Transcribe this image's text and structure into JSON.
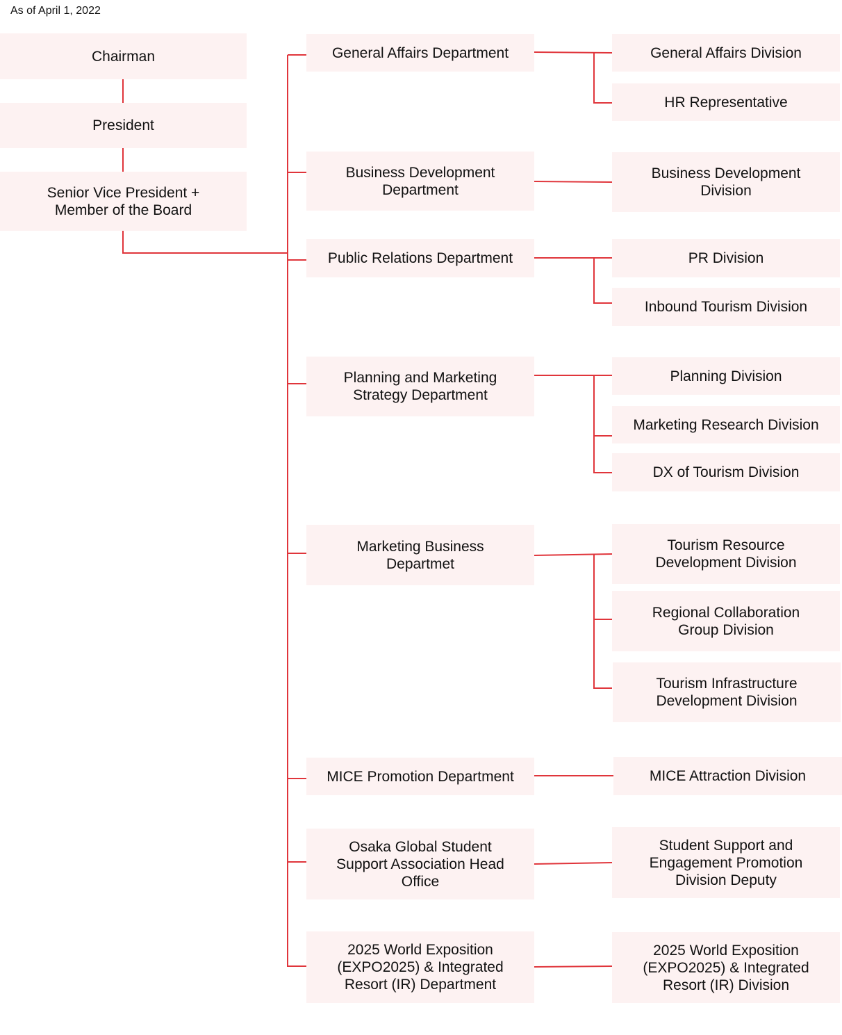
{
  "date_label": "As of April 1, 2022",
  "line_color": "#e0353b",
  "box_color": "#fdf2f2",
  "executives": [
    {
      "id": "chairman",
      "label": "Chairman"
    },
    {
      "id": "president",
      "label": "President"
    },
    {
      "id": "svp",
      "label": "Senior Vice President +\nMember of the Board"
    }
  ],
  "departments": [
    {
      "id": "general-affairs",
      "label": "General Affairs Department",
      "divisions": [
        "General Affairs Division",
        "HR Representative"
      ]
    },
    {
      "id": "business-development",
      "label": "Business Development\nDepartment",
      "divisions": [
        "Business Development\nDivision"
      ]
    },
    {
      "id": "public-relations",
      "label": "Public Relations Department",
      "divisions": [
        "PR Division",
        "Inbound Tourism Division"
      ]
    },
    {
      "id": "planning-marketing",
      "label": "Planning and Marketing\nStrategy Department",
      "divisions": [
        "Planning Division",
        "Marketing Research Division",
        "DX of Tourism Division"
      ]
    },
    {
      "id": "marketing-business",
      "label": "Marketing Business\nDepartmet",
      "divisions": [
        "Tourism Resource\nDevelopment Division",
        "Regional Collaboration\nGroup Division",
        "Tourism Infrastructure\nDevelopment Division"
      ]
    },
    {
      "id": "mice-promotion",
      "label": "MICE Promotion Department",
      "divisions": [
        "MICE Attraction Division"
      ]
    },
    {
      "id": "osaka-global-student",
      "label": "Osaka Global Student\nSupport Association Head\nOffice",
      "divisions": [
        "Student Support and\nEngagement Promotion\nDivision Deputy"
      ]
    },
    {
      "id": "expo2025-ir",
      "label": "2025 World Exposition\n(EXPO2025) & Integrated\nResort (IR) Department",
      "divisions": [
        "2025 World Exposition\n(EXPO2025) & Integrated\nResort (IR) Division"
      ]
    }
  ]
}
